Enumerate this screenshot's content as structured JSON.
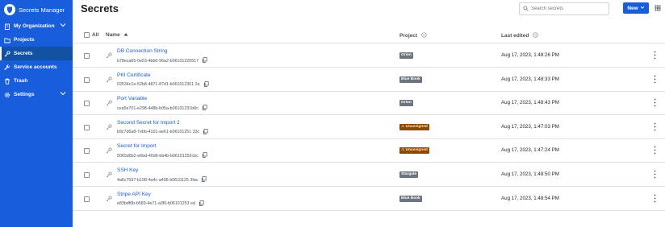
{
  "sidebar": {
    "brand": "Secrets Manager",
    "items": [
      {
        "label": "My Organization",
        "icon": "building-icon",
        "chevron": true
      },
      {
        "label": "Projects",
        "icon": "folder-icon"
      },
      {
        "label": "Secrets",
        "icon": "key-icon",
        "active": true
      },
      {
        "label": "Service accounts",
        "icon": "wrench-icon"
      },
      {
        "label": "Trash",
        "icon": "trash-icon"
      },
      {
        "label": "Settings",
        "icon": "gear-icon",
        "chevron": true
      }
    ]
  },
  "header": {
    "title": "Secrets",
    "search_placeholder": "Search secrets",
    "new_label": "New"
  },
  "table": {
    "columns": {
      "all": "All",
      "name": "Name",
      "project": "Project",
      "last_edited": "Last edited"
    },
    "rows": [
      {
        "name": "DB Connection String",
        "id": "b78eca65-0e53-4bb0-96a2-b06101220517",
        "project": "Orion",
        "warn": false,
        "edited": "Aug 17, 2023, 1:48:26 PM"
      },
      {
        "name": "PKI Certificate",
        "id": "02534c1e-52b8-4871-87d1-b061012301 2a",
        "project": "Blue Book",
        "warn": false,
        "edited": "Aug 17, 2023, 1:48:33 PM"
      },
      {
        "name": "Port Variable",
        "id": "cea5e701-e298-448b-b05a-b06101231b8c",
        "project": "Orion",
        "warn": false,
        "edited": "Aug 17, 2023, 1:48:43 PM"
      },
      {
        "name": "Second Secret for Import 2",
        "id": "b9c7d6a8-7ebb-4101-ae61-b06101251 33c",
        "project": "Unassigned",
        "warn": true,
        "edited": "Aug 17, 2023, 1:47:03 PM"
      },
      {
        "name": "Secret for Import",
        "id": "5065d6b2-e6bd-40d6-bb4b-b06101252cbc",
        "project": "Unassigned",
        "warn": true,
        "edited": "Aug 17, 2023, 1:47:24 PM"
      },
      {
        "name": "SSH Key",
        "id": "4a6c7597-b198-4a4c-a406-b0610125 3fac",
        "project": "Stargate",
        "warn": false,
        "edited": "Aug 17, 2023, 1:48:50 PM"
      },
      {
        "name": "Stripe API Key",
        "id": "e83bdf0b-b589-4e71-a3f0-b06101253 ed",
        "project": "Blue Book",
        "warn": false,
        "edited": "Aug 17, 2023, 1:48:54 PM"
      }
    ]
  },
  "colors": {
    "brand": "#175ddc",
    "warn_badge": "#8c4a00",
    "badge": "#6c757d"
  }
}
